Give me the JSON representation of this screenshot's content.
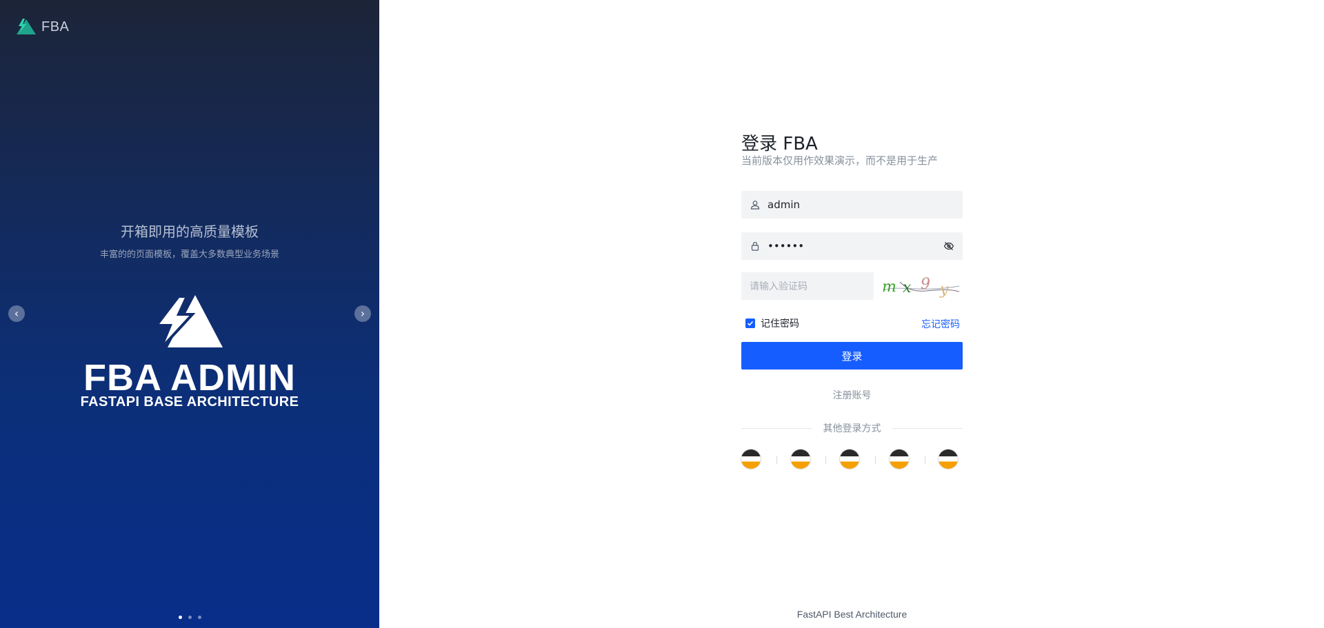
{
  "brand": {
    "name": "FBA"
  },
  "carousel": {
    "title": "开箱即用的高质量模板",
    "subtitle": "丰富的的页面模板，覆盖大多数典型业务场景",
    "hero_title": "FBA ADMIN",
    "hero_subtitle": "FASTAPI BASE ARCHITECTURE",
    "prev_icon": "chevron-left-icon",
    "next_icon": "chevron-right-icon",
    "slides_count": 3,
    "active_slide": 1
  },
  "login": {
    "title": "登录 FBA",
    "subtitle": "当前版本仅用作效果演示，而不是用于生产",
    "username": {
      "value": "admin",
      "icon": "user-icon"
    },
    "password": {
      "value": "••••••",
      "icon": "lock-icon",
      "toggle_icon": "eye-off-icon"
    },
    "captcha": {
      "placeholder": "请输入验证码",
      "image_text": "mx9y"
    },
    "remember": {
      "label": "记住密码",
      "checked": true
    },
    "forgot_label": "忘记密码",
    "submit_label": "登录",
    "register_label": "注册账号",
    "other_methods_label": "其他登录方式",
    "social_count": 5
  },
  "footer": {
    "text": "FastAPI Best Architecture"
  },
  "colors": {
    "primary": "#165dff",
    "brand_teal": "#1fa38a",
    "banner_dark": "#1c2438",
    "banner_blue": "#082e8a"
  }
}
